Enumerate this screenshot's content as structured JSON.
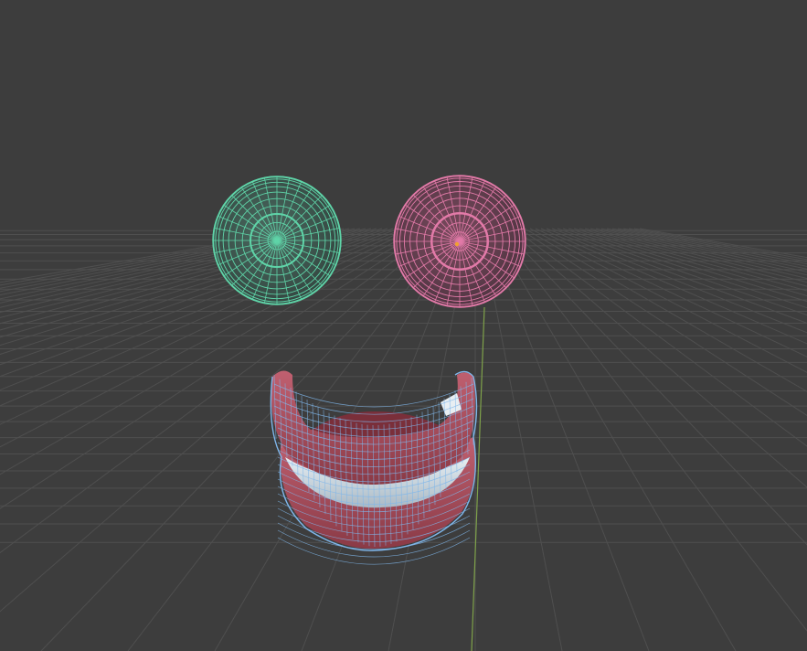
{
  "app": {
    "name": "3D viewport",
    "background_color": "#3d3d3d"
  },
  "viewport": {
    "grid_color": "#4f4f4f",
    "grid_visible": true,
    "y_axis_color": "#7fa24a",
    "objects": [
      {
        "id": "eye-left",
        "kind": "eyeball",
        "wire_color": "#5fd4a8",
        "fill_color": "#3f5a52"
      },
      {
        "id": "eye-right",
        "kind": "eyeball",
        "wire_color": "#e27aa8",
        "fill_color": "#6a3f52",
        "selected": true
      },
      {
        "id": "mouth",
        "kind": "teeth-and-gums",
        "wire_color": "#7fb6ea",
        "gum_color": "#b24e5a",
        "teeth_color": "#d9e6ee"
      }
    ]
  }
}
